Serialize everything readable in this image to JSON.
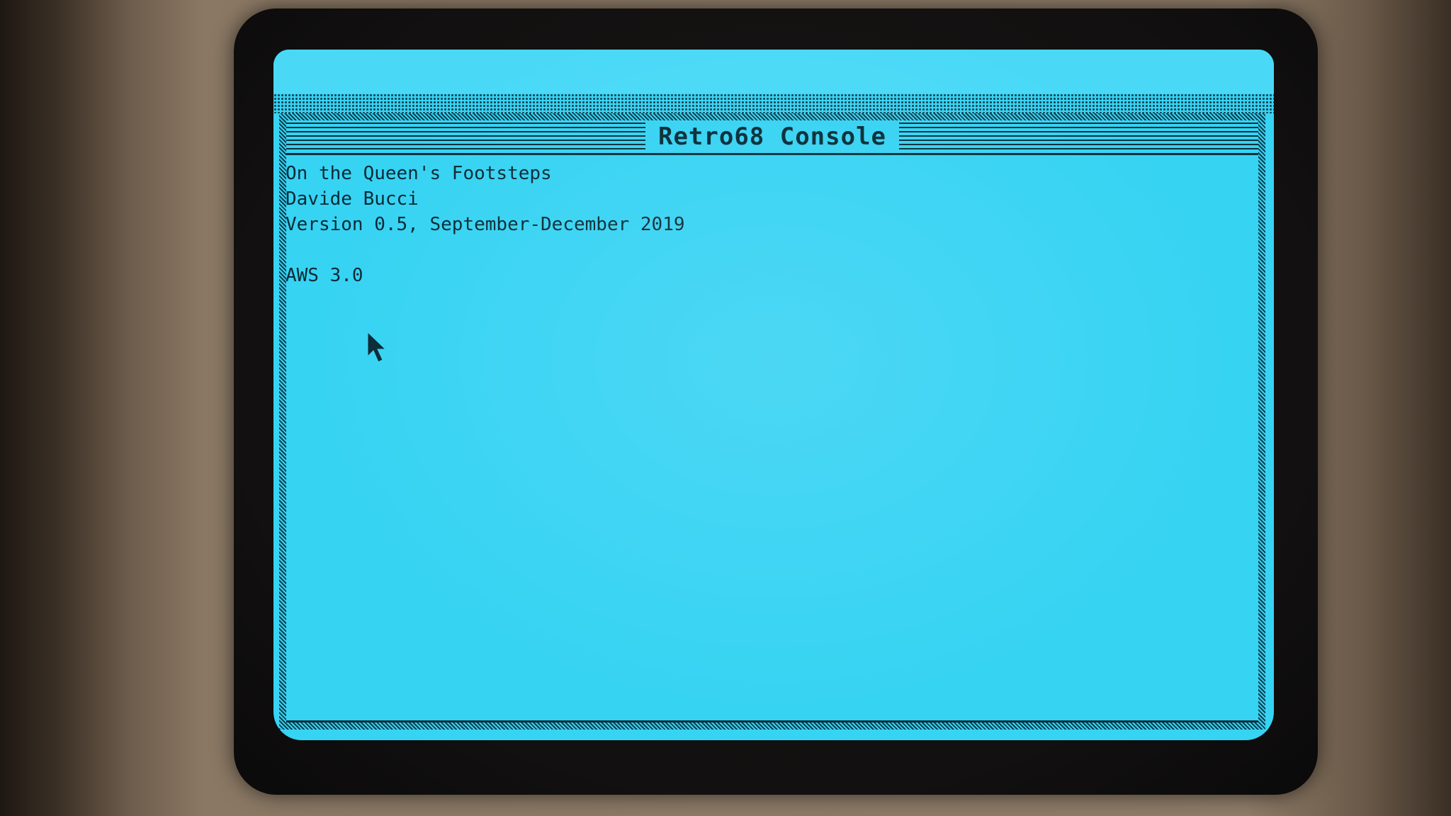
{
  "window": {
    "title": "Retro68 Console"
  },
  "console": {
    "lines": [
      "On the Queen's Footsteps",
      "Davide Bucci",
      "Version 0.5, September-December 2019",
      "",
      "AWS 3.0"
    ]
  },
  "icons": {
    "pointer": "arrow-pointer-icon"
  },
  "colors": {
    "screen": "#37d3f3",
    "text": "#0a2a35",
    "bezel": "#121010"
  }
}
